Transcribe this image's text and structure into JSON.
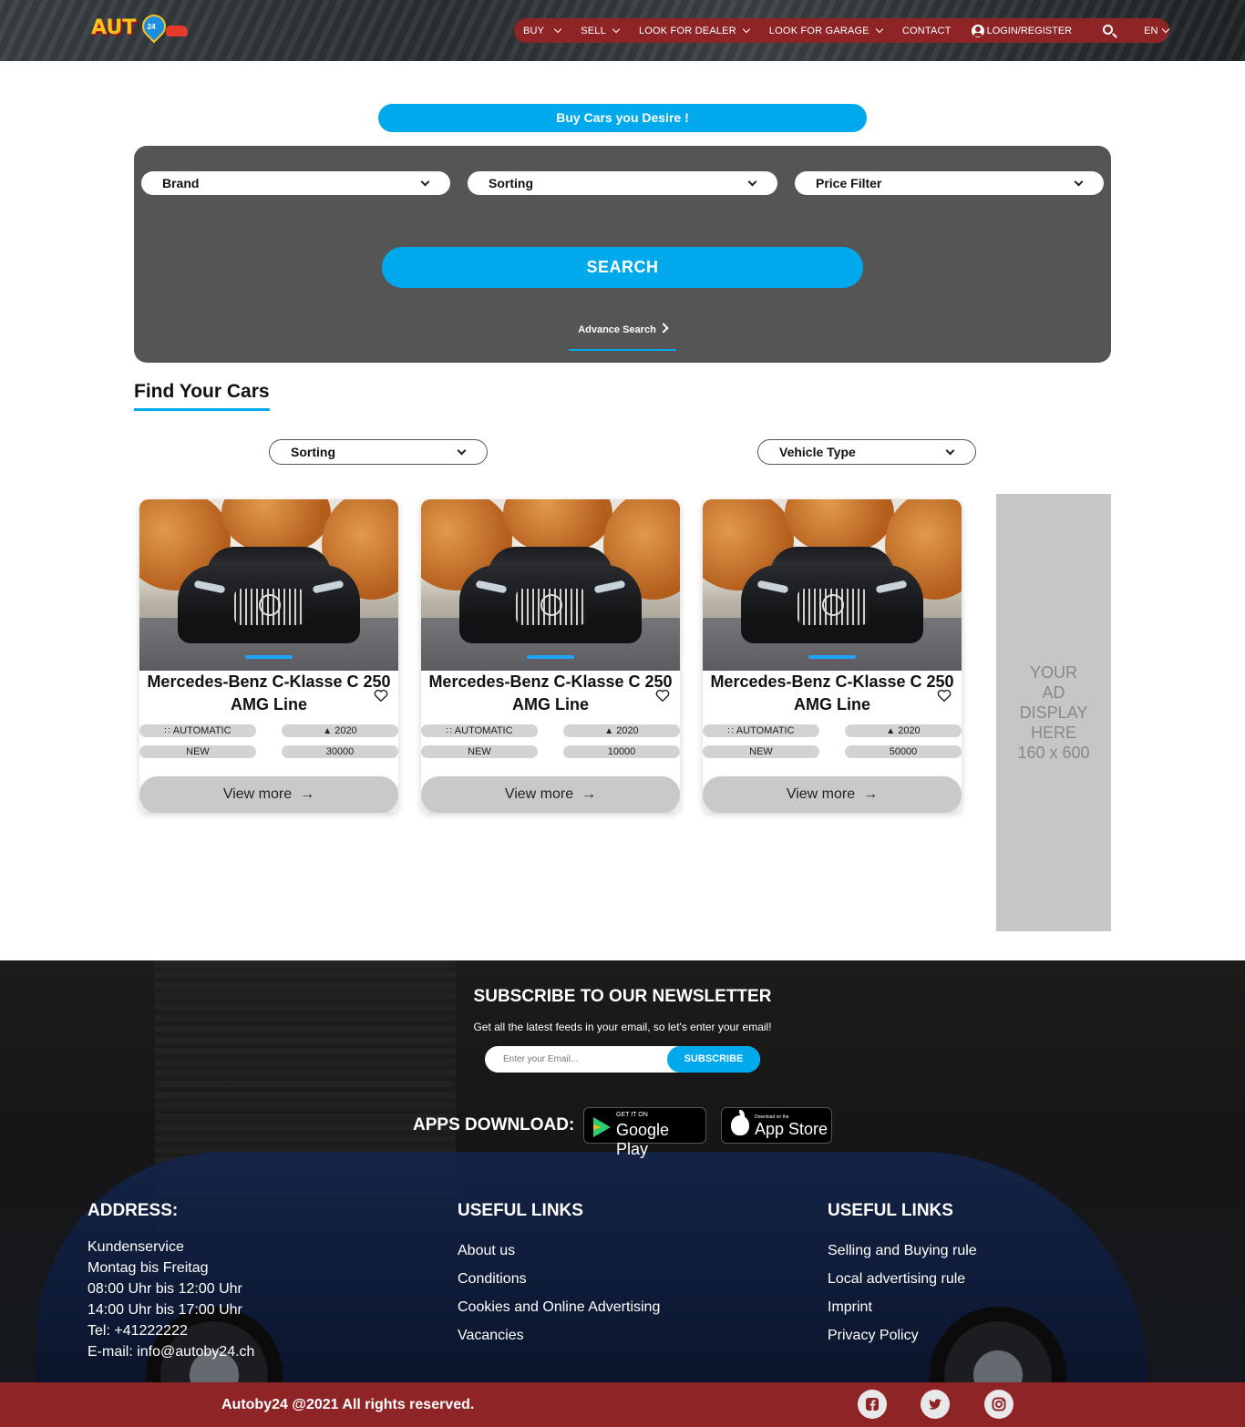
{
  "header": {
    "logo_text": "AUT",
    "logo_pin_text": "24",
    "nav": {
      "buy": "BUY",
      "sell": "SELL",
      "dealer": "LOOK FOR DEALER",
      "garage": "LOOK FOR GARAGE",
      "contact": "CONTACT",
      "login": "LOGIN/REGISTER",
      "lang": "EN"
    }
  },
  "hero": {
    "title": "Buy Cars you Desire !",
    "brand": "Brand",
    "sorting": "Sorting",
    "price": "Price Filter",
    "search": "SEARCH",
    "advanced": "Advance Search"
  },
  "results": {
    "title": "Find Your Cars",
    "sorting": "Sorting",
    "vehicle_type": "Vehicle Type"
  },
  "cars": [
    {
      "title": "Mercedes-Benz C-Klasse C 250 AMG Line",
      "transmission": "AUTOMATIC",
      "year": "2020",
      "condition": "NEW",
      "mileage": "30000",
      "cta": "View more"
    },
    {
      "title": "Mercedes-Benz C-Klasse C 250 AMG Line",
      "transmission": "AUTOMATIC",
      "year": "2020",
      "condition": "NEW",
      "mileage": "10000",
      "cta": "View more"
    },
    {
      "title": "Mercedes-Benz C-Klasse C 250 AMG Line",
      "transmission": "AUTOMATIC",
      "year": "2020",
      "condition": "NEW",
      "mileage": "50000",
      "cta": "View more"
    }
  ],
  "ad": {
    "line1": "YOUR",
    "line2": "AD",
    "line3": "DISPLAY",
    "line4": "HERE",
    "line5": "160 x 600"
  },
  "newsletter": {
    "title": "SUBSCRIBE TO OUR NEWSLETTER",
    "subtitle": "Get all the latest feeds in your email, so let's enter your email!",
    "placeholder": "Enter your Email...",
    "button": "SUBSCRIBE"
  },
  "apps": {
    "label": "APPS DOWNLOAD:",
    "google_small": "GET IT ON",
    "google_big": "Google Play",
    "apple_small": "Download on the",
    "apple_big": "App Store"
  },
  "footer": {
    "address_title": "ADDRESS:",
    "address": [
      "Kundenservice",
      "Montag bis Freitag",
      "08:00 Uhr bis 12:00 Uhr",
      "14:00 Uhr bis 17:00 Uhr",
      "Tel: +41222222",
      "E-mail: info@autoby24.ch"
    ],
    "links1_title": "USEFUL LINKS",
    "links1": [
      "About us",
      "Conditions",
      "Cookies and Online Advertising",
      "Vacancies"
    ],
    "links2_title": "USEFUL LINKS",
    "links2": [
      "Selling and Buying rule",
      "Local advertising rule",
      "Imprint",
      "Privacy Policy"
    ],
    "copyright": "Autoby24 @2021 All rights reserved."
  },
  "colors": {
    "accent": "#00a9ec",
    "brand_red": "#8f2426",
    "panel": "#555556"
  },
  "icons": {
    "social": [
      "facebook-icon",
      "twitter-icon",
      "instagram-icon"
    ]
  }
}
